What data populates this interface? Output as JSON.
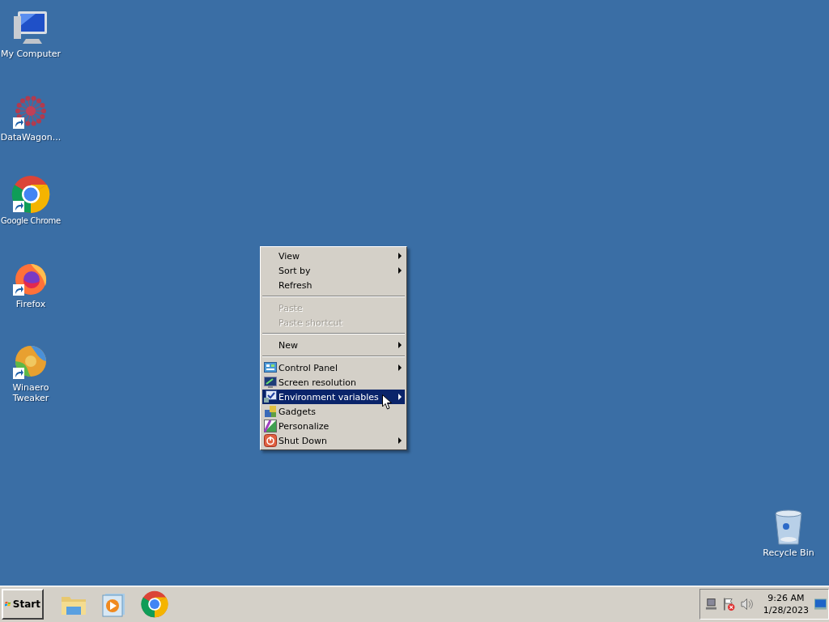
{
  "desktop_icons": [
    {
      "label": "My Computer",
      "shortcut": false
    },
    {
      "label": "DataWagon...",
      "shortcut": true
    },
    {
      "label": "Google Chrome",
      "shortcut": true
    },
    {
      "label": "Firefox",
      "shortcut": true
    },
    {
      "label": "Winaero Tweaker",
      "shortcut": true
    }
  ],
  "recycle_bin": {
    "label": "Recycle Bin"
  },
  "context_menu": {
    "items": [
      {
        "kind": "command",
        "label": "View",
        "disabled": false,
        "submenu": true,
        "selected": false
      },
      {
        "kind": "command",
        "label": "Sort by",
        "disabled": false,
        "submenu": true,
        "selected": false
      },
      {
        "kind": "command",
        "label": "Refresh",
        "disabled": false,
        "submenu": false,
        "selected": false
      },
      {
        "kind": "separator"
      },
      {
        "kind": "command",
        "label": "Paste",
        "disabled": true,
        "submenu": false,
        "selected": false
      },
      {
        "kind": "command",
        "label": "Paste shortcut",
        "disabled": true,
        "submenu": false,
        "selected": false
      },
      {
        "kind": "separator"
      },
      {
        "kind": "command",
        "label": "New",
        "disabled": false,
        "submenu": true,
        "selected": false
      },
      {
        "kind": "separator"
      },
      {
        "kind": "command",
        "label": "Control Panel",
        "disabled": false,
        "submenu": true,
        "selected": false
      },
      {
        "kind": "command",
        "label": "Screen resolution",
        "disabled": false,
        "submenu": false,
        "selected": false
      },
      {
        "kind": "command",
        "label": "Environment variables",
        "disabled": false,
        "submenu": true,
        "selected": true
      },
      {
        "kind": "command",
        "label": "Gadgets",
        "disabled": false,
        "submenu": false,
        "selected": false
      },
      {
        "kind": "command",
        "label": "Personalize",
        "disabled": false,
        "submenu": false,
        "selected": false
      },
      {
        "kind": "command",
        "label": "Shut Down",
        "disabled": false,
        "submenu": true,
        "selected": false
      }
    ]
  },
  "taskbar": {
    "start_label": "Start",
    "clock": {
      "time": "9:26 AM",
      "date": "1/28/2023"
    }
  }
}
